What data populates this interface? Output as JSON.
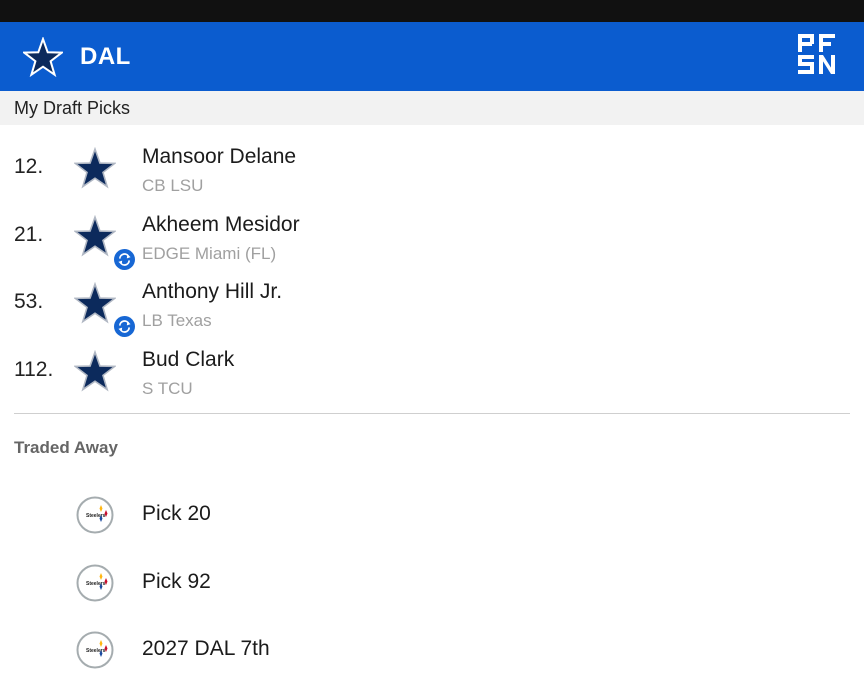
{
  "header": {
    "team_code": "DAL",
    "brand_logo_icon": "pfsn-logo",
    "background_color": "#0b5ccf"
  },
  "my_picks": {
    "section_title": "My Draft Picks",
    "items": [
      {
        "number": "12.",
        "name": "Mansoor Delane",
        "info": "CB LSU",
        "traded_for": false,
        "team_icon": "cowboys-star-icon"
      },
      {
        "number": "21.",
        "name": "Akheem Mesidor",
        "info": "EDGE Miami (FL)",
        "traded_for": true,
        "team_icon": "cowboys-star-icon"
      },
      {
        "number": "53.",
        "name": "Anthony Hill Jr.",
        "info": "LB Texas",
        "traded_for": true,
        "team_icon": "cowboys-star-icon"
      },
      {
        "number": "112.",
        "name": "Bud Clark",
        "info": "S TCU",
        "traded_for": false,
        "team_icon": "cowboys-star-icon"
      }
    ]
  },
  "traded_away": {
    "section_title": "Traded Away",
    "items": [
      {
        "label": "Pick 20",
        "team_icon": "steelers-logo-icon"
      },
      {
        "label": "Pick 92",
        "team_icon": "steelers-logo-icon"
      },
      {
        "label": "2027 DAL 7th",
        "team_icon": "steelers-logo-icon"
      }
    ]
  },
  "colors": {
    "accent_blue": "#0b5ccf",
    "cowboys_navy": "#0c2a5c",
    "trade_badge": "#1767d4",
    "secondary_text": "#a0a0a0"
  }
}
